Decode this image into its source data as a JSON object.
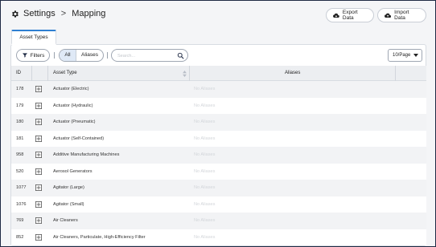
{
  "header": {
    "breadcrumb_root": "Settings",
    "breadcrumb_sep": ">",
    "breadcrumb_current": "Mapping",
    "export_label": "Export Data",
    "import_label": "Import Data"
  },
  "tabs": [
    {
      "label": "Asset Types",
      "active": true
    }
  ],
  "toolbar": {
    "filters_label": "Filters",
    "segment": {
      "all": "All",
      "aliases": "Aliases",
      "selected": "All"
    },
    "search_placeholder": "Search...",
    "page_size": "10/Page"
  },
  "table": {
    "columns": {
      "id": "ID",
      "type": "Asset Type",
      "aliases": "Aliases"
    },
    "rows": [
      {
        "id": "178",
        "type": "Actuator (Electric)",
        "aliases": "No Aliases"
      },
      {
        "id": "179",
        "type": "Actuator (Hydraulic)",
        "aliases": "No Aliases"
      },
      {
        "id": "180",
        "type": "Actuator (Pneumatic)",
        "aliases": "No Aliases"
      },
      {
        "id": "181",
        "type": "Actuator (Self-Contained)",
        "aliases": "No Aliases"
      },
      {
        "id": "958",
        "type": "Additive Manufacturing Machines",
        "aliases": "No Aliases"
      },
      {
        "id": "520",
        "type": "Aerosol Generators",
        "aliases": "No Aliases"
      },
      {
        "id": "1077",
        "type": "Agitator (Large)",
        "aliases": "No Aliases"
      },
      {
        "id": "1076",
        "type": "Agitator (Small)",
        "aliases": "No Aliases"
      },
      {
        "id": "769",
        "type": "Air Cleaners",
        "aliases": "No Aliases"
      },
      {
        "id": "852",
        "type": "Air Cleaners, Particulate, High-Efficiency Filter",
        "aliases": "No Aliases"
      }
    ]
  },
  "colors": {
    "accent": "#2f7fd1",
    "header_row": "#eceef1",
    "striped_row": "#f2f3f5"
  }
}
